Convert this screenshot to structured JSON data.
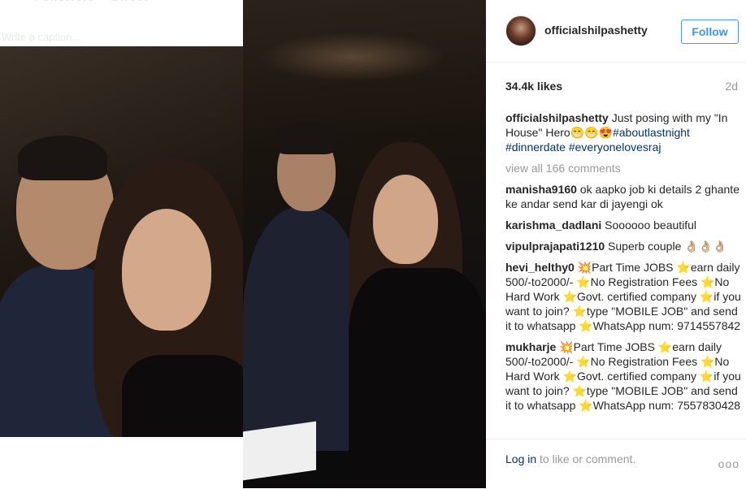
{
  "left_panel": {
    "tabs": [
      "Followers",
      "Direct"
    ],
    "caption_placeholder": "Write a caption..."
  },
  "post": {
    "username": "officialshilpashetty",
    "follow_label": "Follow",
    "likes": "34.4k likes",
    "age": "2d",
    "caption": {
      "user": "officialshilpashetty",
      "text": " Just posing with my \"In House\" Hero😁😁😍",
      "tags": [
        "#aboutlastnight",
        "#dinnerdate",
        "#everyonelovesraj"
      ]
    },
    "view_all": "view all 166 comments",
    "comments": [
      {
        "user": "manisha9160",
        "text": " ok aapko job ki details 2 ghante ke andar send kar di jayengi ok"
      },
      {
        "user": "karishma_dadlani",
        "text": " Soooooo beautiful"
      },
      {
        "user": "vipulprajapati1210",
        "text": " Superb couple 👌🏼👌🏼👌🏼"
      },
      {
        "user": "hevi_helthy0",
        "text": " 💥Part Time JOBS ⭐earn daily 500/-to2000/- ⭐No Registration Fees ⭐No Hard Work ⭐Govt. certified company ⭐if you want to join? ⭐type \"MOBILE JOB\" and send it to whatsapp ⭐WhatsApp num: 9714557842"
      },
      {
        "user": "mukharje",
        "text": " 💥Part Time JOBS ⭐earn daily 500/-to2000/- ⭐No Registration Fees ⭐No Hard Work ⭐Govt. certified company ⭐if you want to join? ⭐type \"MOBILE JOB\" and send it to whatsapp ⭐WhatsApp num: 7557830428"
      }
    ],
    "footer": {
      "login_link": "Log in",
      "login_text": " to like or comment.",
      "more_icon": "ooo"
    }
  },
  "colors": {
    "link_blue": "#3897f0",
    "tag_blue": "#003569",
    "muted_gray": "#999999"
  }
}
